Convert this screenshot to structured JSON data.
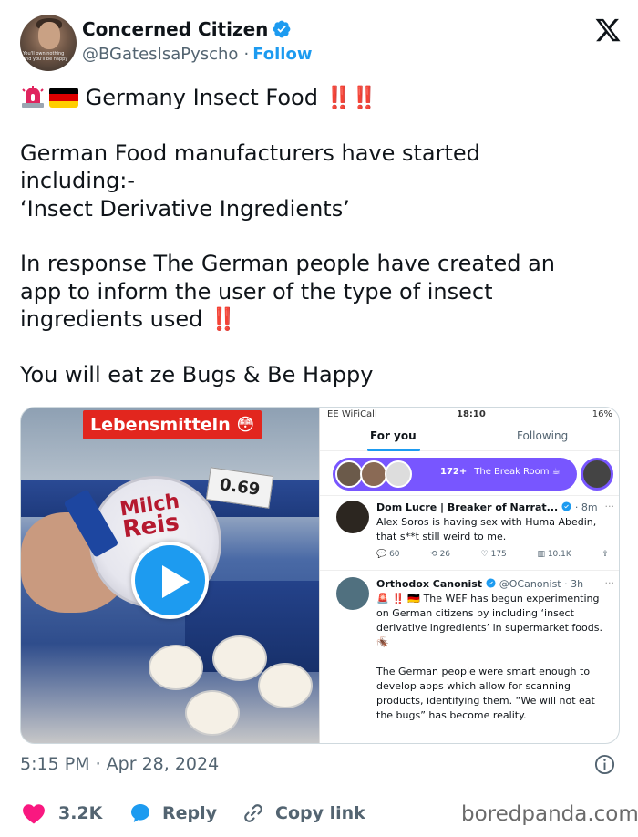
{
  "author": {
    "display_name": "Concerned Citizen",
    "handle": "@BGatesIsaPyscho",
    "separator": "·",
    "follow_label": "Follow",
    "avatar_text": "You'll own nothing and you'll be happy"
  },
  "tweet": {
    "title": "Germany Insect Food",
    "title_marks": "‼️‼️",
    "paragraph1_line1": "German Food manufacturers have started",
    "paragraph1_line2": "including:-",
    "paragraph1_line3": "‘Insect Derivative Ingredients’",
    "paragraph2_line1": "In response The German people have created an",
    "paragraph2_line2": "app to inform the user of the type of insect",
    "paragraph2_line3": "ingredients used",
    "paragraph2_marks": "‼️",
    "paragraph3": "You will eat ze Bugs & Be Happy"
  },
  "media": {
    "video_label": "Lebensmitteln 😳",
    "price": "0.69",
    "cup_brand_line1": "Milch",
    "cup_brand_line2": "Reis",
    "phone": {
      "status_left": "EE WiFiCall",
      "status_time": "18:10",
      "status_battery": "16%",
      "tab_for_you": "For you",
      "tab_following": "Following",
      "spaces_count": "172+",
      "spaces_title": "The Break Room ☕",
      "post1": {
        "name": "Dom Lucre | Breaker of Narrat...",
        "meta": "· 8m",
        "text": "Alex Soros is having sex with Huma Abedin, that s**t still weird to me.",
        "replies": "60",
        "reposts": "26",
        "likes": "175",
        "views": "10.1K"
      },
      "post2": {
        "name": "Orthodox Canonist",
        "meta": "@OCanonist · 3h",
        "text1": "🚨 ‼️ 🇩🇪 The WEF has begun experimenting on German citizens by including ‘insect derivative ingredients’ in supermarket foods. 🪳",
        "text2": "The German people were smart enough to develop apps which allow for scanning products, identifying them. “We will not eat the bugs” has become reality."
      }
    }
  },
  "footer": {
    "timestamp": "5:15 PM · Apr 28, 2024",
    "likes_count": "3.2K",
    "reply_label": "Reply",
    "copy_link_label": "Copy link",
    "watermark": "boredpanda.com"
  },
  "colors": {
    "accent": "#1d9bf0",
    "like": "#f91880",
    "text": "#0f1419",
    "muted": "#536471",
    "spaces": "#7856ff"
  },
  "icons": [
    "verified-badge-icon",
    "x-logo-icon",
    "siren-icon",
    "german-flag-icon",
    "play-icon",
    "info-icon",
    "heart-icon",
    "reply-bubble-icon",
    "link-icon"
  ]
}
